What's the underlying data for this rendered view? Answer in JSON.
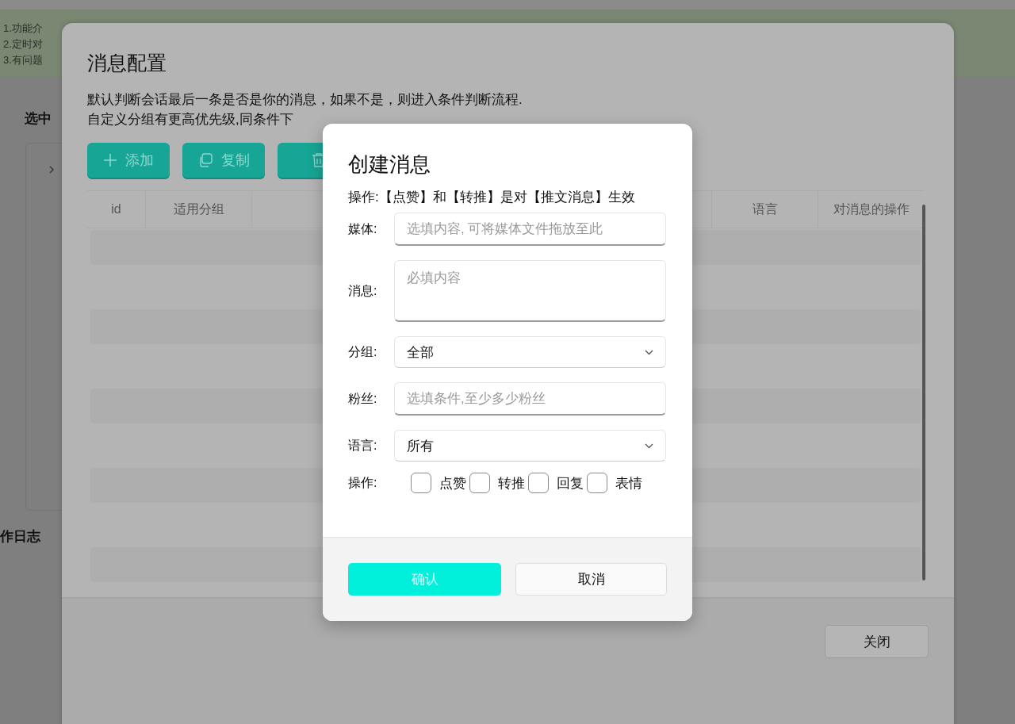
{
  "page": {
    "notice_lines": [
      "1.功能介",
      "2.定时对",
      "3.有问题"
    ],
    "section_title": "选中",
    "log_title": "作日志"
  },
  "config_modal": {
    "title": "消息配置",
    "description_lines": [
      "默认判断会话最后一条是否是你的消息，如果不是，则进入条件判断流程.",
      "自定义分组有更高优先级,同条件下"
    ],
    "toolbar": [
      {
        "kind": "add",
        "label": "添加"
      },
      {
        "kind": "copy",
        "label": "复制"
      },
      {
        "kind": "delete"
      }
    ],
    "table": {
      "columns": [
        {
          "label": "id"
        },
        {
          "label": "适用分组"
        },
        {
          "label": "语言"
        },
        {
          "label": "对消息的操作"
        }
      ]
    },
    "close_button": "关闭"
  },
  "dialog": {
    "title": "创建消息",
    "note": "操作:【点赞】和【转推】是对【推文消息】生效",
    "fields": [
      {
        "kind": "input",
        "label": "媒体:",
        "placeholder": "选填内容, 可将媒体文件拖放至此"
      },
      {
        "kind": "textarea",
        "label": "消息:",
        "placeholder": "必填内容"
      },
      {
        "kind": "select",
        "label": "分组:",
        "value": "全部"
      },
      {
        "kind": "input",
        "label": "粉丝:",
        "placeholder": "选填条件,至少多少粉丝"
      },
      {
        "kind": "select",
        "label": "语言:",
        "value": "所有"
      }
    ],
    "operations": {
      "label": "操作:",
      "options": [
        {
          "label": "点赞",
          "checked": false
        },
        {
          "label": "转推",
          "checked": false
        },
        {
          "label": "回复",
          "checked": false
        },
        {
          "label": "表情",
          "checked": false
        }
      ]
    },
    "buttons": [
      {
        "kind": "primary",
        "label": "确认"
      },
      {
        "kind": "secondary",
        "label": "取消"
      }
    ]
  }
}
